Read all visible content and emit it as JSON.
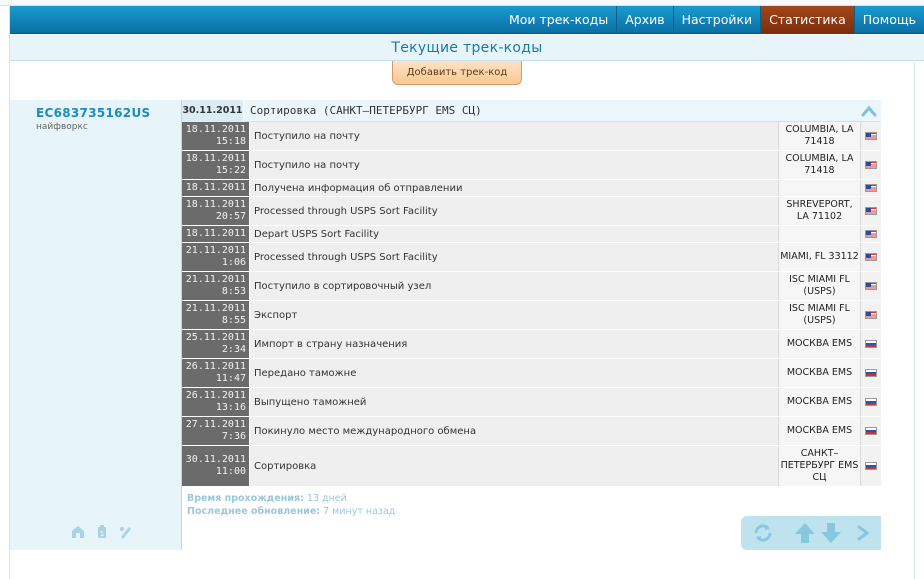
{
  "top_strip": {
    "tiny_text": ""
  },
  "nav": {
    "tabs": [
      {
        "label": "Мои трек-коды",
        "active": false
      },
      {
        "label": "Архив",
        "active": false
      },
      {
        "label": "Настройки",
        "active": false
      },
      {
        "label": "Статистика",
        "active": true
      },
      {
        "label": "Помощь",
        "active": false
      }
    ]
  },
  "subheader": {
    "title": "Текущие трек-коды"
  },
  "add_button": {
    "label": "Добавить трек-код"
  },
  "track": {
    "code": "EC683735162US",
    "name": "найфворкс",
    "current_date": "30.11.2011",
    "current_status": "Сортировка (САНКТ–ПЕТЕРБУРГ EMS СЦ)",
    "events": [
      {
        "date": "18.11.2011",
        "time": "15:18",
        "desc": "Поступило на почту",
        "loc": "COLUMBIA, LA 71418",
        "flag": "us"
      },
      {
        "date": "18.11.2011",
        "time": "15:22",
        "desc": "Поступило на почту",
        "loc": "COLUMBIA, LA 71418",
        "flag": "us"
      },
      {
        "date": "18.11.2011",
        "time": "",
        "desc": "Получена информация об отправлении",
        "loc": "",
        "flag": "us"
      },
      {
        "date": "18.11.2011",
        "time": "20:57",
        "desc": "Processed through USPS Sort Facility",
        "loc": "SHREVEPORT, LA 71102",
        "flag": "us"
      },
      {
        "date": "18.11.2011",
        "time": "",
        "desc": "Depart USPS Sort Facility",
        "loc": "",
        "flag": "us"
      },
      {
        "date": "21.11.2011",
        "time": "1:06",
        "desc": "Processed through USPS Sort Facility",
        "loc": "MIAMI, FL 33112",
        "flag": "us"
      },
      {
        "date": "21.11.2011",
        "time": "8:53",
        "desc": "Поступило в сортировочный узел",
        "loc": "ISC MIAMI FL (USPS)",
        "flag": "us"
      },
      {
        "date": "21.11.2011",
        "time": "8:55",
        "desc": "Экспорт",
        "loc": "ISC MIAMI FL (USPS)",
        "flag": "us"
      },
      {
        "date": "25.11.2011",
        "time": "2:34",
        "desc": "Импорт в страну назначения",
        "loc": "МОСКВА EMS",
        "flag": "ru"
      },
      {
        "date": "26.11.2011",
        "time": "11:47",
        "desc": "Передано таможне",
        "loc": "МОСКВА EMS",
        "flag": "ru"
      },
      {
        "date": "26.11.2011",
        "time": "13:16",
        "desc": "Выпущено таможней",
        "loc": "МОСКВА EMS",
        "flag": "ru"
      },
      {
        "date": "27.11.2011",
        "time": "7:36",
        "desc": "Покинуло место международного обмена",
        "loc": "МОСКВА EMS",
        "flag": "ru"
      },
      {
        "date": "30.11.2011",
        "time": "11:00",
        "desc": "Сортировка",
        "loc": "САНКТ–ПЕТЕРБУРГ EMS СЦ",
        "flag": "ru"
      }
    ],
    "transit_label": "Время прохождения:",
    "transit_value": "13 дней",
    "updated_label": "Последнее обновление:",
    "updated_value": "7 минут назад"
  },
  "colors": {
    "nav_blue": "#0a6fa3",
    "active_tab": "#8a3510",
    "accent_text": "#1a8cbf",
    "panel_bg": "#e7f4fa",
    "timestamp_bg": "#6b6b6b"
  },
  "icons": {
    "left_actions": [
      "archive-icon",
      "delete-icon",
      "edit-icon"
    ],
    "controls": [
      "refresh-icon",
      "move-up-icon",
      "move-down-icon",
      "next-icon"
    ],
    "collapse": "chevron-up-icon"
  }
}
